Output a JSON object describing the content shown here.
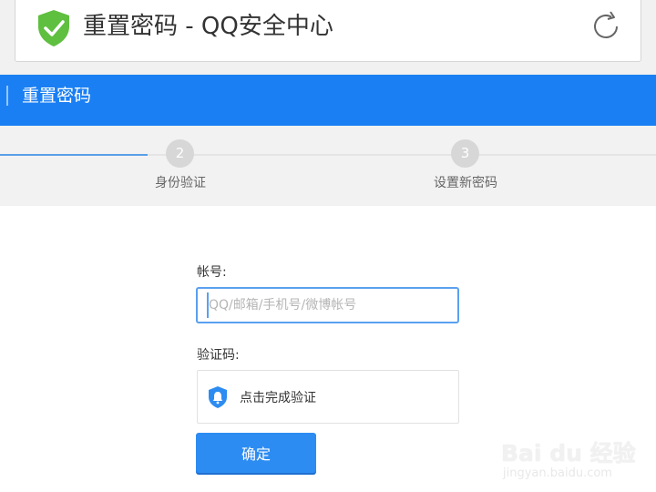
{
  "header": {
    "title": "重置密码 - QQ安全中心",
    "shield_icon": "shield-check-icon",
    "refresh_icon": "refresh-icon"
  },
  "section": {
    "title": "重置密码"
  },
  "steps": [
    {
      "number": "2",
      "label": "身份验证"
    },
    {
      "number": "3",
      "label": "设置新密码"
    }
  ],
  "form": {
    "account_label": "帐号:",
    "account_placeholder": "QQ/邮箱/手机号/微博帐号",
    "account_value": "",
    "captcha_label": "验证码:",
    "captcha_text": "点击完成验证",
    "submit_label": "确定"
  },
  "watermark": {
    "brand": "Bai du 经验",
    "url": "jingyan.baidu.com"
  },
  "colors": {
    "accent": "#1a7ff3",
    "button": "#2d8cf2",
    "shield": "#5fbf3f"
  }
}
